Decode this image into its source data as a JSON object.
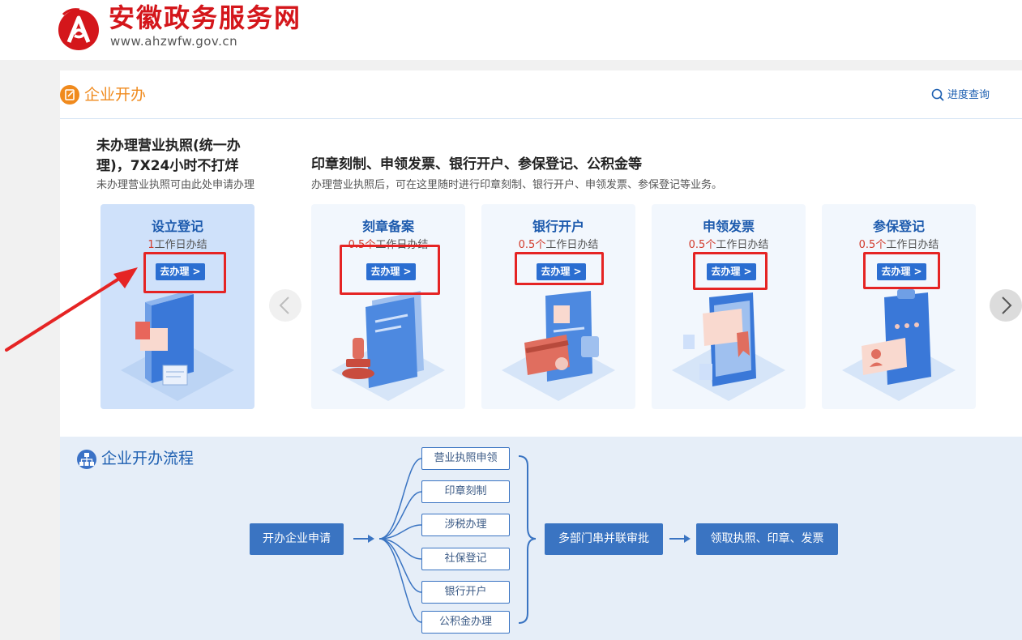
{
  "header": {
    "site_name": "安徽政务服务网",
    "site_url": "www.ahzwfw.gov.cn"
  },
  "section": {
    "title": "企业开办",
    "progress_query": "进度查询"
  },
  "left_column": {
    "title": "未办理营业执照(统一办理)，7X24小时不打烊",
    "description": "未办理营业执照可由此处申请办理"
  },
  "right_column": {
    "title": "印章刻制、申领发票、银行开户、参保登记、公积金等",
    "description": "办理营业执照后，可在这里随时进行印章刻制、银行开户、申领发票、参保登记等业务。"
  },
  "cards": [
    {
      "title": "设立登记",
      "time_num": "1",
      "time_unit": "工作日办结",
      "button": "去办理 >",
      "illustration": "book-document-illustration"
    },
    {
      "title": "刻章备案",
      "time_num": "0.5个",
      "time_unit": "工作日办结",
      "button": "去办理 >",
      "illustration": "stamp-document-illustration"
    },
    {
      "title": "银行开户",
      "time_num": "0.5个",
      "time_unit": "工作日办结",
      "button": "去办理 >",
      "illustration": "bank-card-illustration"
    },
    {
      "title": "申领发票",
      "time_num": "0.5个",
      "time_unit": "工作日办结",
      "button": "去办理 >",
      "illustration": "invoice-phone-illustration"
    },
    {
      "title": "参保登记",
      "time_num": "0.5个",
      "time_unit": "工作日办结",
      "button": "去办理 >",
      "illustration": "clipboard-id-illustration"
    }
  ],
  "carousel": {
    "prev_icon": "chevron-left-icon",
    "next_icon": "chevron-right-icon"
  },
  "flow": {
    "title": "企业开办流程",
    "start": "开办企业申请",
    "items": [
      "营业执照申领",
      "印章刻制",
      "涉税办理",
      "社保登记",
      "银行开户",
      "公积金办理"
    ],
    "approve": "多部门串并联审批",
    "result": "领取执照、印章、发票"
  },
  "colors": {
    "brand_red": "#d4161b",
    "accent_orange": "#f08a1d",
    "primary_blue": "#2b6ed1",
    "annotation_red": "#e52424"
  }
}
